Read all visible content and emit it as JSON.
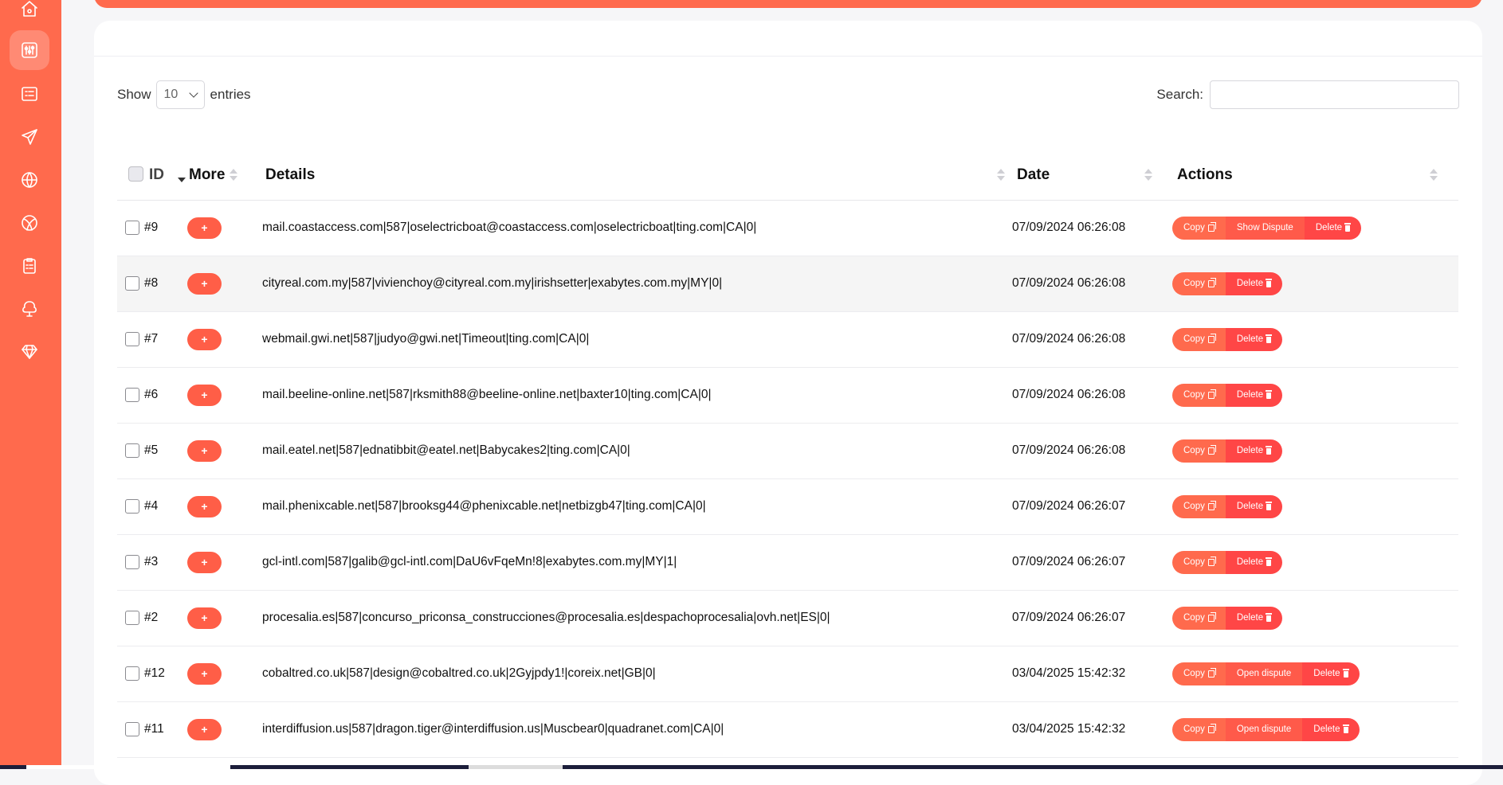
{
  "sidebar": {
    "icons": [
      "home-icon",
      "sliders-icon",
      "list-icon",
      "send-icon",
      "globe-icon",
      "ball-icon",
      "clipboard-icon",
      "tree-icon",
      "diamond-icon"
    ],
    "active_index": 1
  },
  "controls": {
    "show_label": "Show",
    "entries_value": "10",
    "entries_label": "entries",
    "search_label": "Search:",
    "search_value": ""
  },
  "table": {
    "headers": {
      "id": "ID",
      "more": "More",
      "details": "Details",
      "date": "Date",
      "actions": "Actions"
    },
    "rows": [
      {
        "id": "#9",
        "more": "+",
        "details": "mail.coastaccess.com|587|oselectricboat@coastaccess.com|oselectricboat|ting.com|CA|0|",
        "date": "07/09/2024 06:26:08",
        "copy": "Copy",
        "mid": "Show Dispute",
        "delete": "Delete"
      },
      {
        "id": "#8",
        "more": "+",
        "details": "cityreal.com.my|587|vivienchoy@cityreal.com.my|irishsetter|exabytes.com.my|MY|0|",
        "date": "07/09/2024 06:26:08",
        "copy": "Copy",
        "mid": "",
        "delete": "Delete"
      },
      {
        "id": "#7",
        "more": "+",
        "details": "webmail.gwi.net|587|judyo@gwi.net|Timeout|ting.com|CA|0|",
        "date": "07/09/2024 06:26:08",
        "copy": "Copy",
        "mid": "",
        "delete": "Delete"
      },
      {
        "id": "#6",
        "more": "+",
        "details": "mail.beeline-online.net|587|rksmith88@beeline-online.net|baxter10|ting.com|CA|0|",
        "date": "07/09/2024 06:26:08",
        "copy": "Copy",
        "mid": "",
        "delete": "Delete"
      },
      {
        "id": "#5",
        "more": "+",
        "details": "mail.eatel.net|587|ednatibbit@eatel.net|Babycakes2|ting.com|CA|0|",
        "date": "07/09/2024 06:26:08",
        "copy": "Copy",
        "mid": "",
        "delete": "Delete"
      },
      {
        "id": "#4",
        "more": "+",
        "details": "mail.phenixcable.net|587|brooksg44@phenixcable.net|netbizgb47|ting.com|CA|0|",
        "date": "07/09/2024 06:26:07",
        "copy": "Copy",
        "mid": "",
        "delete": "Delete"
      },
      {
        "id": "#3",
        "more": "+",
        "details": "gcl-intl.com|587|galib@gcl-intl.com|DaU6vFqeMn!8|exabytes.com.my|MY|1|",
        "date": "07/09/2024 06:26:07",
        "copy": "Copy",
        "mid": "",
        "delete": "Delete"
      },
      {
        "id": "#2",
        "more": "+",
        "details": "procesalia.es|587|concurso_priconsa_construcciones@procesalia.es|despachoprocesalia|ovh.net|ES|0|",
        "date": "07/09/2024 06:26:07",
        "copy": "Copy",
        "mid": "",
        "delete": "Delete"
      },
      {
        "id": "#12",
        "more": "+",
        "details": "cobaltred.co.uk|587|design@cobaltred.co.uk|2Gyjpdy1!|coreix.net|GB|0|",
        "date": "03/04/2025 15:42:32",
        "copy": "Copy",
        "mid": "Open dispute",
        "delete": "Delete"
      },
      {
        "id": "#11",
        "more": "+",
        "details": "interdiffusion.us|587|dragon.tiger@interdiffusion.us|Muscbear0|quadranet.com|CA|0|",
        "date": "03/04/2025 15:42:32",
        "copy": "Copy",
        "mid": "Open dispute",
        "delete": "Delete"
      }
    ]
  },
  "colors": {
    "accent": "#ff6a4d",
    "delete": "#ff4646"
  }
}
